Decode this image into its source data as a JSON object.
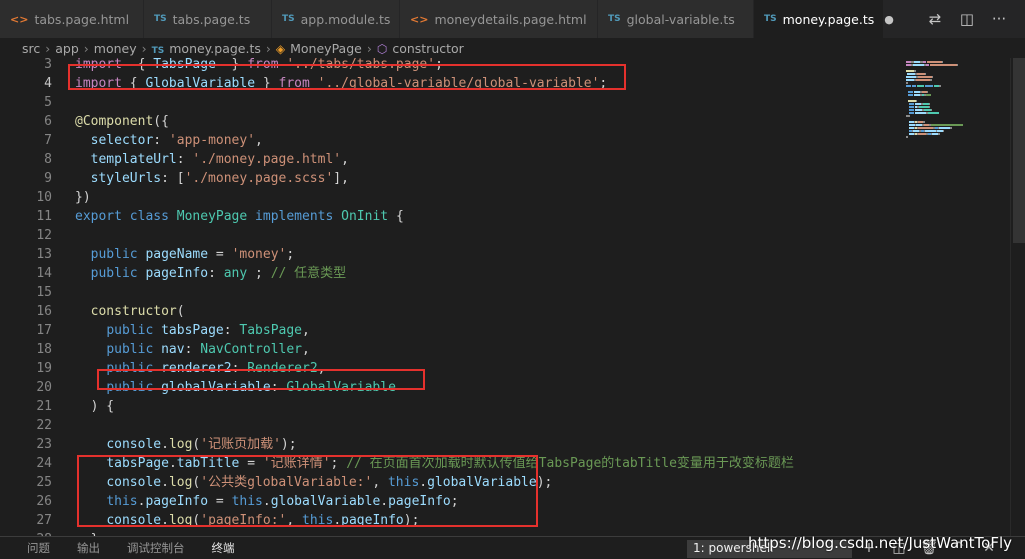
{
  "tabs": [
    {
      "icon": "html",
      "glyph": "<>",
      "label": "tabs.page.html"
    },
    {
      "icon": "ts",
      "glyph": "TS",
      "label": "tabs.page.ts"
    },
    {
      "icon": "ts",
      "glyph": "TS",
      "label": "app.module.ts"
    },
    {
      "icon": "html",
      "glyph": "<>",
      "label": "moneydetails.page.html"
    },
    {
      "icon": "ts",
      "glyph": "TS",
      "label": "global-variable.ts"
    },
    {
      "icon": "ts",
      "glyph": "TS",
      "label": "money.page.ts",
      "active": true,
      "dirty": "●"
    }
  ],
  "tab_actions": [
    {
      "name": "git-compare-icon",
      "glyph": "⇄"
    },
    {
      "name": "split-editor-icon",
      "glyph": "◫"
    },
    {
      "name": "more-actions-icon",
      "glyph": "···"
    }
  ],
  "breadcrumb": {
    "items": [
      "src",
      "app",
      "money",
      "money.page.ts",
      "MoneyPage",
      "constructor"
    ],
    "ts_glyph": "TS",
    "class_glyph": "◈",
    "ctor_glyph": "⬡"
  },
  "code": {
    "first_line_number": 3,
    "current_line": 4,
    "lines": [
      [
        [
          "kc",
          "import"
        ],
        [
          "",
          "  { "
        ],
        [
          "prop",
          "TabsPage"
        ],
        [
          "",
          "  } "
        ],
        [
          "kc",
          "from"
        ],
        [
          "",
          ""
        ],
        [
          "str",
          " '../tabs/tabs.page'"
        ],
        [
          "",
          ";"
        ]
      ],
      [
        [
          "kc",
          "import"
        ],
        [
          "",
          " { "
        ],
        [
          "prop",
          "GlobalVariable"
        ],
        [
          "",
          " } "
        ],
        [
          "kc",
          "from"
        ],
        [
          "",
          " "
        ],
        [
          "str",
          "'../global-variable/global-variable'"
        ],
        [
          "",
          ";"
        ]
      ],
      [],
      [
        [
          "deco",
          "@Component"
        ],
        [
          "",
          "({"
        ]
      ],
      [
        [
          "",
          ""
        ],
        [
          "prop",
          "  selector"
        ],
        [
          "",
          ": "
        ],
        [
          "str",
          "'app-money'"
        ],
        [
          "",
          ","
        ]
      ],
      [
        [
          "prop",
          "  templateUrl"
        ],
        [
          "",
          ": "
        ],
        [
          "str",
          "'./money.page.html'"
        ],
        [
          "",
          ","
        ]
      ],
      [
        [
          "prop",
          "  styleUrls"
        ],
        [
          "",
          ": ["
        ],
        [
          "str",
          "'./money.page.scss'"
        ],
        [
          "",
          "],"
        ]
      ],
      [
        [
          "",
          "})"
        ]
      ],
      [
        [
          "kw",
          "export"
        ],
        [
          "",
          " "
        ],
        [
          "kw",
          "class"
        ],
        [
          "",
          " "
        ],
        [
          "cls",
          "MoneyPage"
        ],
        [
          "",
          " "
        ],
        [
          "kw",
          "implements"
        ],
        [
          "",
          " "
        ],
        [
          "cls",
          "OnInit"
        ],
        [
          "",
          " {"
        ]
      ],
      [],
      [
        [
          "",
          "  "
        ],
        [
          "kw",
          "public"
        ],
        [
          "",
          " "
        ],
        [
          "prop",
          "pageName"
        ],
        [
          "",
          " = "
        ],
        [
          "str",
          "'money'"
        ],
        [
          "",
          ";"
        ]
      ],
      [
        [
          "",
          "  "
        ],
        [
          "kw",
          "public"
        ],
        [
          "",
          " "
        ],
        [
          "prop",
          "pageInfo"
        ],
        [
          "",
          ": "
        ],
        [
          "cls",
          "any"
        ],
        [
          "",
          " ; "
        ],
        [
          "cm",
          "// 任意类型"
        ]
      ],
      [],
      [
        [
          "",
          "  "
        ],
        [
          "fn",
          "constructor"
        ],
        [
          "",
          "("
        ]
      ],
      [
        [
          "",
          "    "
        ],
        [
          "kw",
          "public"
        ],
        [
          "",
          " "
        ],
        [
          "prop",
          "tabsPage"
        ],
        [
          "",
          ": "
        ],
        [
          "cls",
          "TabsPage"
        ],
        [
          "",
          ","
        ]
      ],
      [
        [
          "",
          "    "
        ],
        [
          "kw",
          "public"
        ],
        [
          "",
          " "
        ],
        [
          "prop",
          "nav"
        ],
        [
          "",
          ": "
        ],
        [
          "cls",
          "NavController"
        ],
        [
          "",
          ","
        ]
      ],
      [
        [
          "",
          "    "
        ],
        [
          "kw",
          "public"
        ],
        [
          "",
          " "
        ],
        [
          "prop",
          "renderer2"
        ],
        [
          "",
          ": "
        ],
        [
          "cls",
          "Renderer2"
        ],
        [
          "",
          ","
        ]
      ],
      [
        [
          "",
          "    "
        ],
        [
          "kw",
          "public"
        ],
        [
          "",
          " "
        ],
        [
          "prop",
          "globalVariable"
        ],
        [
          "",
          ": "
        ],
        [
          "cls",
          "GlobalVariable"
        ]
      ],
      [
        [
          "",
          "  ) {"
        ]
      ],
      [],
      [
        [
          "",
          "    "
        ],
        [
          "prop",
          "console"
        ],
        [
          "",
          "."
        ],
        [
          "fn",
          "log"
        ],
        [
          "",
          "("
        ],
        [
          "str",
          "'记账页加载'"
        ],
        [
          "",
          ");"
        ]
      ],
      [
        [
          "",
          "    "
        ],
        [
          "prop",
          "tabsPage"
        ],
        [
          "",
          "."
        ],
        [
          "prop",
          "tabTitle"
        ],
        [
          "",
          " = "
        ],
        [
          "str",
          "'记账详情'"
        ],
        [
          "",
          "; "
        ],
        [
          "cm",
          "// 在页面首次加载时默认传值给TabsPage的tabTitle变量用于改变标题栏"
        ]
      ],
      [
        [
          "",
          "    "
        ],
        [
          "prop",
          "console"
        ],
        [
          "",
          "."
        ],
        [
          "fn",
          "log"
        ],
        [
          "",
          "("
        ],
        [
          "str",
          "'公共类globalVariable:'"
        ],
        [
          "",
          ", "
        ],
        [
          "kw",
          "this"
        ],
        [
          "",
          "."
        ],
        [
          "prop",
          "globalVariable"
        ],
        [
          "",
          ");"
        ]
      ],
      [
        [
          "",
          "    "
        ],
        [
          "kw",
          "this"
        ],
        [
          "",
          "."
        ],
        [
          "prop",
          "pageInfo"
        ],
        [
          "",
          " = "
        ],
        [
          "kw",
          "this"
        ],
        [
          "",
          "."
        ],
        [
          "prop",
          "globalVariable"
        ],
        [
          "",
          "."
        ],
        [
          "prop",
          "pageInfo"
        ],
        [
          "",
          ";"
        ]
      ],
      [
        [
          "",
          "    "
        ],
        [
          "prop",
          "console"
        ],
        [
          "",
          "."
        ],
        [
          "fn",
          "log"
        ],
        [
          "",
          "("
        ],
        [
          "str",
          "'pageInfo:'"
        ],
        [
          "",
          ", "
        ],
        [
          "kw",
          "this"
        ],
        [
          "",
          "."
        ],
        [
          "prop",
          "pageInfo"
        ],
        [
          "",
          ");"
        ]
      ],
      [
        [
          "",
          "  }"
        ]
      ]
    ]
  },
  "highlight_color": "#e5312d",
  "panel": {
    "tabs": [
      "问题",
      "输出",
      "调试控制台",
      "终端"
    ],
    "active_tab": "终端",
    "terminal_select": "1: powershell",
    "actions": [
      {
        "name": "new-terminal-icon",
        "glyph": "+"
      },
      {
        "name": "split-terminal-icon",
        "glyph": "◫"
      },
      {
        "name": "kill-terminal-icon",
        "glyph": "🗑"
      },
      {
        "name": "maximize-panel-icon",
        "glyph": "^"
      },
      {
        "name": "close-panel-icon",
        "glyph": "✕"
      }
    ]
  },
  "watermark": "https://blog.csdn.net/JustWantToFly"
}
